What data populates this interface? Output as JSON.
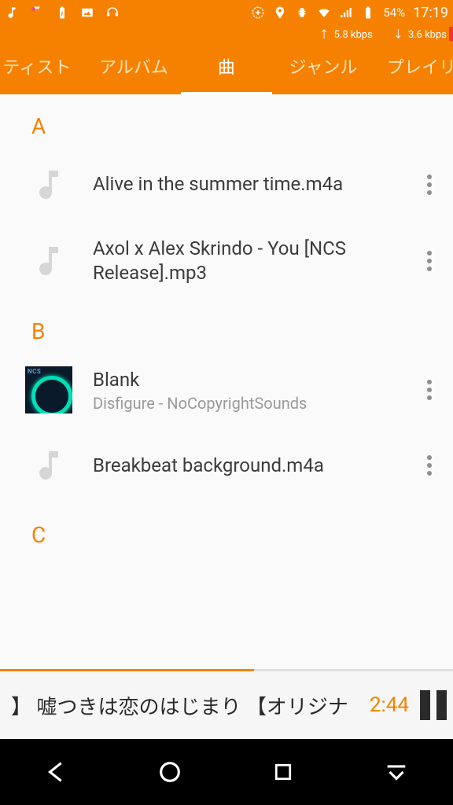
{
  "status": {
    "battery_pct": "54%",
    "time": "17:19",
    "kbps_up": "5.8 kbps",
    "kbps_down": "3.6 kbps"
  },
  "tabs": {
    "artist": "ティスト",
    "album": "アルバム",
    "songs": "曲",
    "genre": "ジャンル",
    "playlist": "プレイリ"
  },
  "sections": [
    {
      "letter": "A",
      "songs": [
        {
          "title": "Alive in the summer time.m4a",
          "subtitle": "",
          "cover": false
        },
        {
          "title": "Axol x Alex Skrindo - You [NCS Release].mp3",
          "subtitle": "",
          "cover": false
        }
      ]
    },
    {
      "letter": "B",
      "songs": [
        {
          "title": "Blank",
          "subtitle": "Disfigure - NoCopyrightSounds",
          "cover": true
        },
        {
          "title": "Breakbeat background.m4a",
          "subtitle": "",
          "cover": false
        }
      ]
    },
    {
      "letter": "C",
      "songs": []
    }
  ],
  "nowplaying": {
    "title": "】 嘘つきは恋のはじまり  【オリジナ",
    "time": "2:44"
  }
}
